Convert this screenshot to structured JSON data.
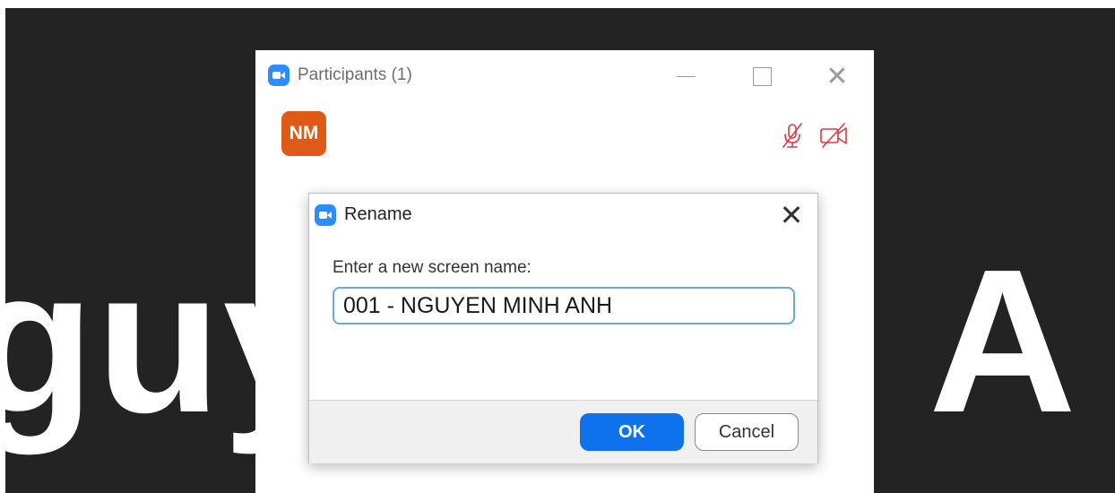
{
  "background": {
    "left_text": "guy",
    "right_text": "h A"
  },
  "participants_window": {
    "title": "Participants (1)",
    "icons": [
      "zoom-logo-icon",
      "minimize-icon",
      "maximize-icon",
      "close-icon"
    ],
    "participant": {
      "initials": "NM",
      "avatar_color": "#e05a17",
      "status_icons": [
        "mic-muted-icon",
        "video-off-icon"
      ],
      "status_color": "#e0383e"
    }
  },
  "rename_dialog": {
    "title": "Rename",
    "prompt": "Enter a new screen name:",
    "input_value": "001 - NGUYEN MINH ANH",
    "ok_label": "OK",
    "cancel_label": "Cancel",
    "accent_color": "#0e72ed"
  }
}
